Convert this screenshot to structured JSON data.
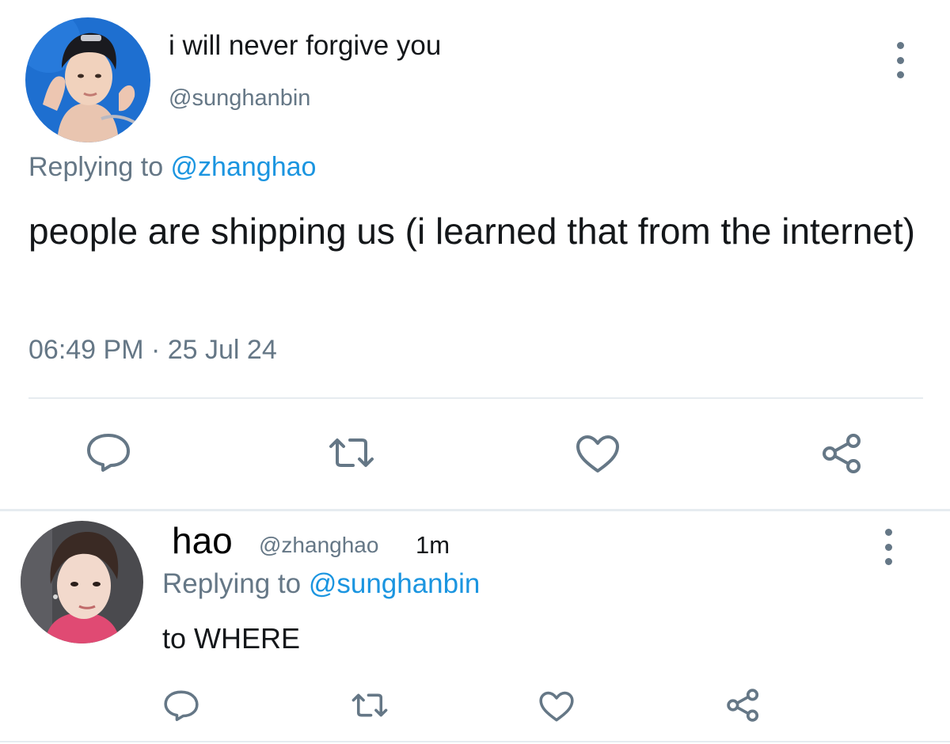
{
  "main_tweet": {
    "display_name": "i will never forgive you",
    "handle": "@sunghanbin",
    "replying_prefix": "Replying to ",
    "replying_to": "@zhanghao",
    "body": "people are shipping us (i learned that from the internet)",
    "timestamp": "06:49 PM · 25 Jul 24",
    "actions": [
      "reply-icon",
      "retweet-icon",
      "like-icon",
      "share-icon"
    ]
  },
  "reply_tweet": {
    "display_name": "hao",
    "handle": "@zhanghao",
    "time_ago": "1m",
    "replying_prefix": "Replying to ",
    "replying_to": "@sunghanbin",
    "body": "to WHERE",
    "actions": [
      "reply-icon",
      "retweet-icon",
      "like-icon",
      "share-icon"
    ]
  },
  "colors": {
    "text": "#14171a",
    "secondary": "#657786",
    "accent": "#1b95e0",
    "divider": "#e6ecf0",
    "avatar_main_bg": "#1e6fd0"
  }
}
